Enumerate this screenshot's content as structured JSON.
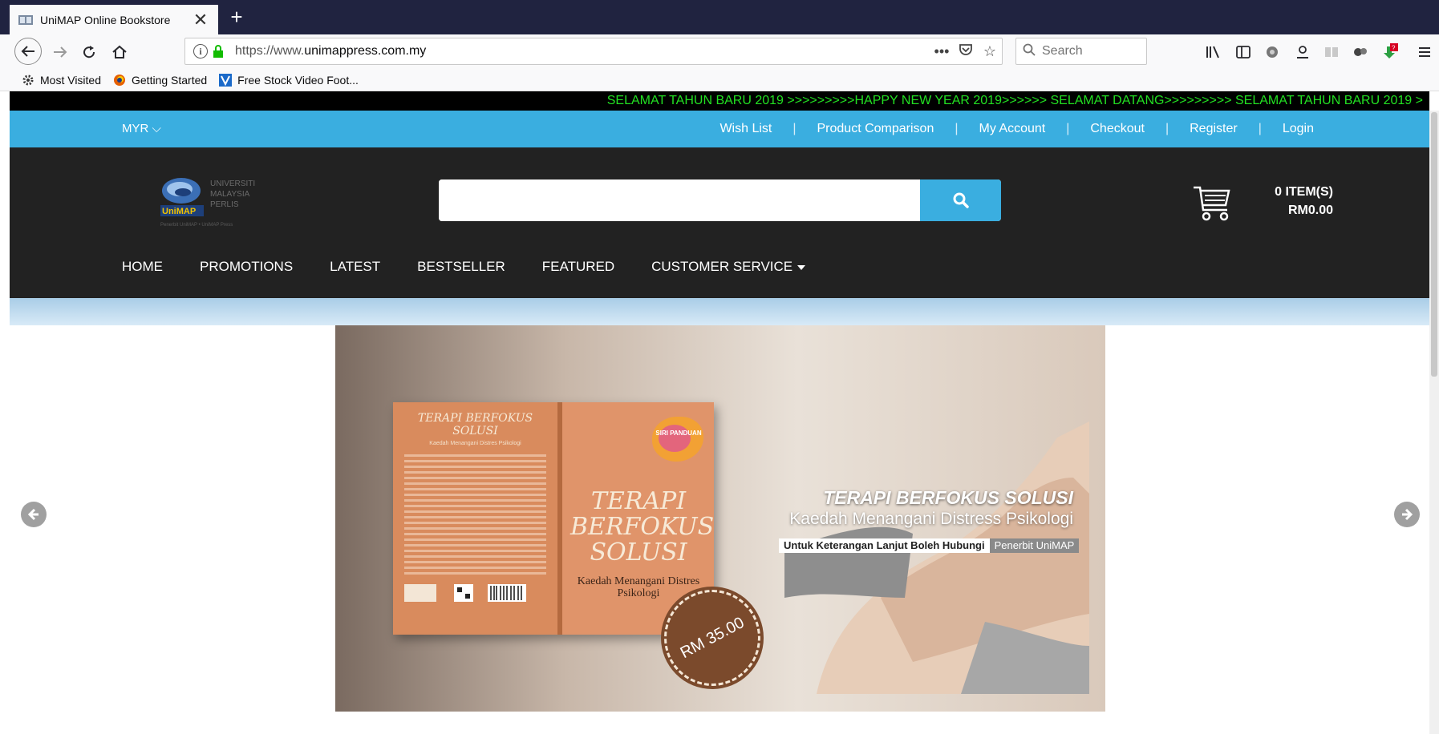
{
  "browser": {
    "tab_title": "UniMAP Online Bookstore",
    "tab_close": "✕",
    "new_tab": "+",
    "url_prefix": "https://www.",
    "url_domain": "unimappress.com.my",
    "search_placeholder": "Search",
    "more": "•••",
    "bookmarks": [
      {
        "label": "Most Visited"
      },
      {
        "label": "Getting Started"
      },
      {
        "label": "Free Stock Video Foot..."
      }
    ]
  },
  "site": {
    "marquee": "SELAMAT TAHUN BARU 2019 >>>>>>>>>HAPPY NEW YEAR 2019>>>>>> SELAMAT DATANG>>>>>>>>> SELAMAT TAHUN BARU 2019 >",
    "currency": "MYR ⌵",
    "top_links": [
      "Wish List",
      "Product Comparison",
      "My Account",
      "Checkout",
      "Register",
      "Login"
    ],
    "separator": "|",
    "logo": {
      "l1": "UNIVERSITI",
      "l2": "MALAYSIA",
      "l3": "PERLIS",
      "mark": "UniMAP",
      "tagline": "Penerbit UniMAP • UniMAP Press"
    },
    "cart": {
      "items": "0 ITEM(S)",
      "total": "RM0.00"
    },
    "menu": [
      "HOME",
      "PROMOTIONS",
      "LATEST",
      "BESTSELLER",
      "FEATURED",
      "CUSTOMER SERVICE"
    ],
    "colors": {
      "accent": "#3aaee0",
      "header": "#222222",
      "marquee_text": "#22e022"
    }
  },
  "banner": {
    "title": "TERAPI BERFOKUS SOLUSI",
    "subtitle": "Kaedah Menangani Distress Psikologi",
    "contact_text": "Untuk Keterangan Lanjut Boleh Hubungi",
    "contact_highlight": "Penerbit UniMAP",
    "price": "RM 35.00",
    "book_title": "TERAPI BERFOKUS SOLUSI",
    "book_subtitle": "Kaedah Menangani Distres Psikologi",
    "book_badge": "SIRI PANDUAN"
  }
}
